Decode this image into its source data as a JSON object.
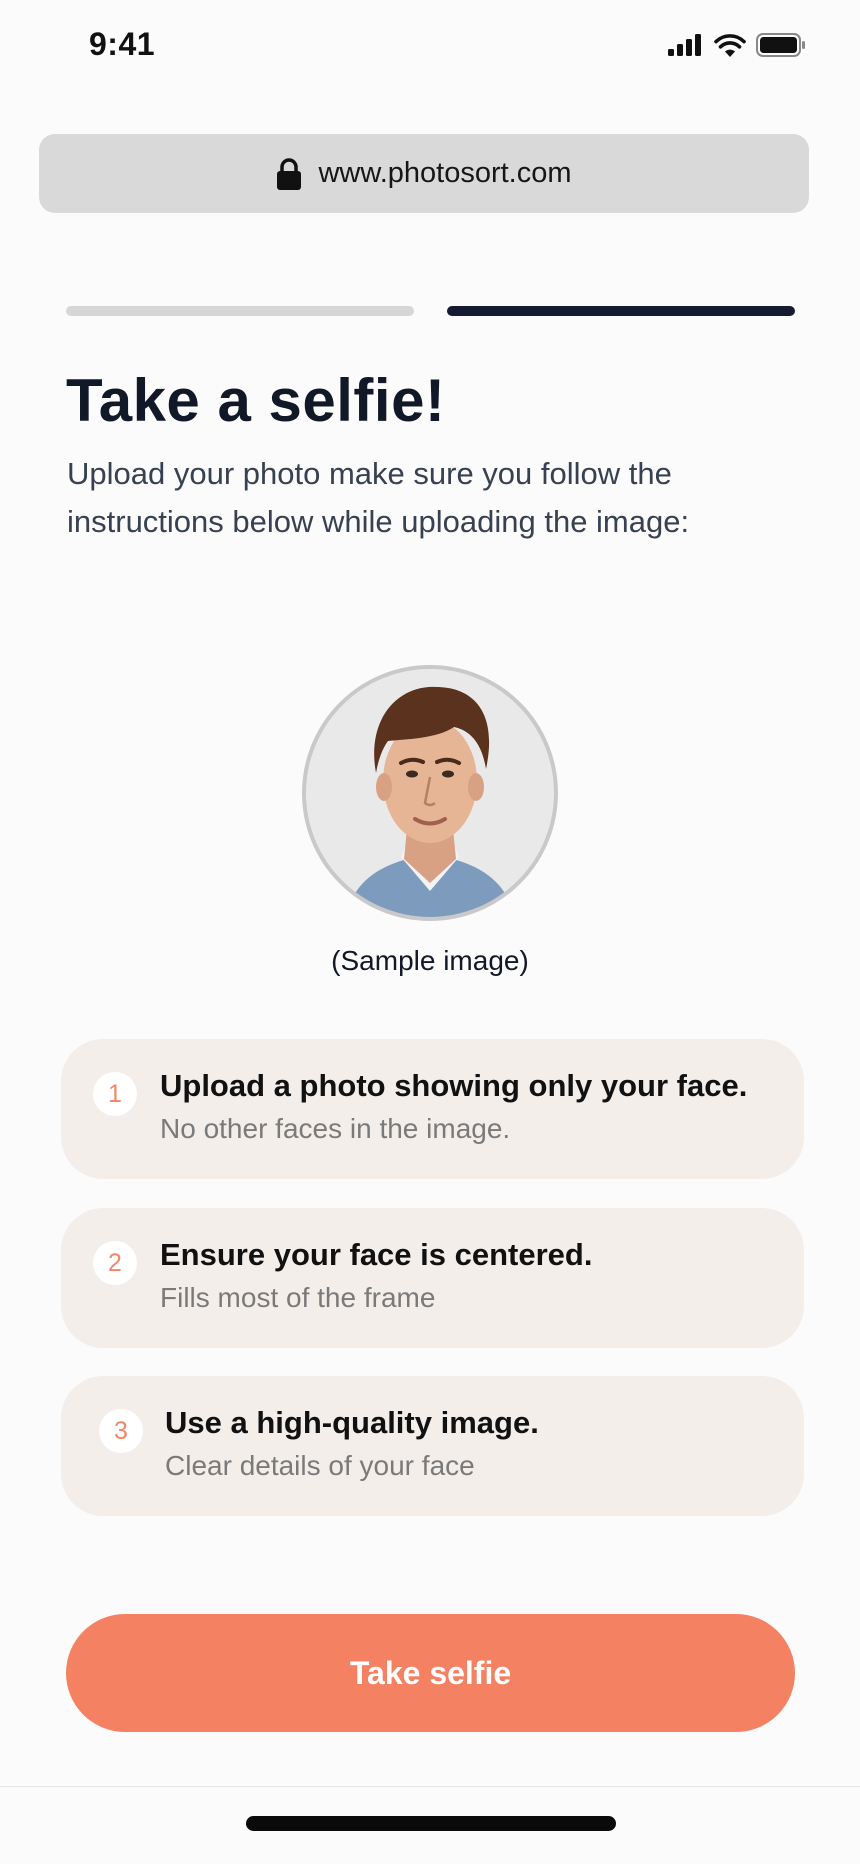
{
  "status_bar": {
    "time": "9:41",
    "icons": [
      "signal-icon",
      "wifi-icon",
      "battery-icon"
    ]
  },
  "browser": {
    "url": "www.photosort.com",
    "icon": "lock-icon"
  },
  "progress": {
    "total_steps": 2,
    "current_step": 2,
    "active_color": "#141b33",
    "inactive_color": "#d6d6d6"
  },
  "page": {
    "title": "Take a selfie!",
    "subtitle": "Upload your photo make sure you follow the instructions below while uploading the image:"
  },
  "sample": {
    "caption": "(Sample image)"
  },
  "instructions": [
    {
      "number": "1",
      "title": "Upload a photo showing only your face.",
      "description": "No other faces in the image."
    },
    {
      "number": "2",
      "title": "Ensure your face is centered.",
      "description": "Fills most of the frame"
    },
    {
      "number": "3",
      "title": "Use a high-quality image.",
      "description": "Clear details of your face"
    }
  ],
  "cta": {
    "label": "Take selfie",
    "color": "#f58163"
  },
  "colors": {
    "card_background": "#f3eeea",
    "accent": "#f38667",
    "heading": "#111827"
  }
}
